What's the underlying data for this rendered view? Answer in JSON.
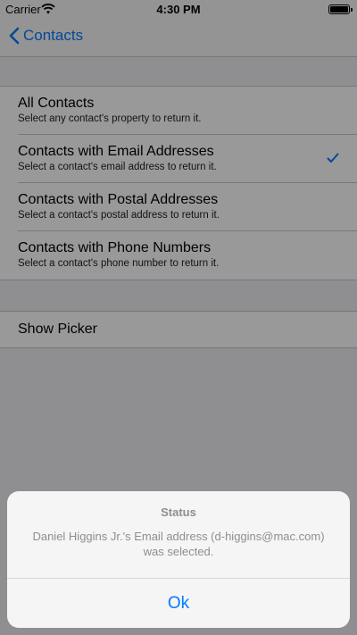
{
  "status_bar": {
    "carrier": "Carrier",
    "time": "4:30 PM"
  },
  "nav": {
    "back_label": "Contacts"
  },
  "options": [
    {
      "title": "All Contacts",
      "subtitle": "Select any contact's property to return it.",
      "checked": false
    },
    {
      "title": "Contacts with Email Addresses",
      "subtitle": "Select a contact's email address to return it.",
      "checked": true
    },
    {
      "title": "Contacts with Postal Addresses",
      "subtitle": "Select a contact's postal address to return it.",
      "checked": false
    },
    {
      "title": "Contacts with Phone Numbers",
      "subtitle": "Select a contact's phone number to return it.",
      "checked": false
    }
  ],
  "action": {
    "show_picker_label": "Show Picker"
  },
  "alert": {
    "title": "Status",
    "message": "Daniel Higgins Jr.'s Email address (d-higgins@mac.com) was selected.",
    "ok_label": "Ok"
  },
  "colors": {
    "accent": "#007aff",
    "background": "#efeff4",
    "overlay": "rgba(0,0,0,0.4)"
  }
}
